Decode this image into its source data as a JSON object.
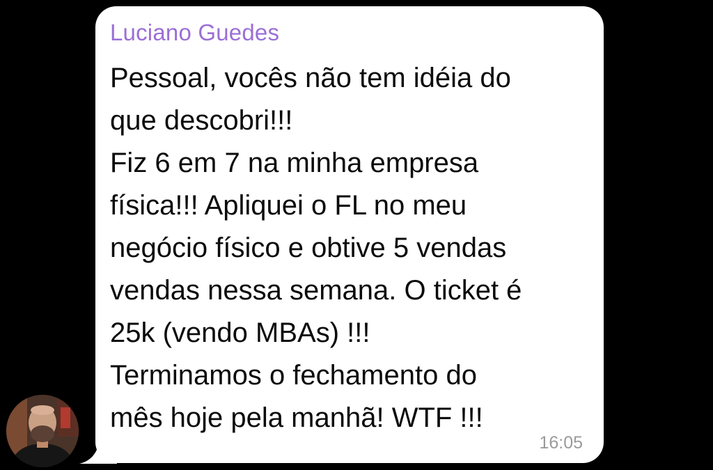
{
  "message": {
    "sender": "Luciano Guedes",
    "lines": [
      "Pessoal, vocês não tem idéia do",
      "que descobri!!!",
      "Fiz 6 em 7 na minha empresa",
      "física!!! Apliquei o FL no meu",
      "negócio físico e obtive 5 vendas",
      "vendas nessa semana. O ticket é",
      "25k (vendo MBAs) !!!",
      "Terminamos o fechamento do",
      "mês hoje pela manhã! WTF !!!"
    ],
    "time": "16:05"
  },
  "avatar": {
    "icon": "user-photo-avatar"
  },
  "colors": {
    "background": "#000000",
    "bubble": "#ffffff",
    "sender_name": "#9b6fd6",
    "text": "#0b0b0b",
    "timestamp": "#9a9a9a"
  }
}
